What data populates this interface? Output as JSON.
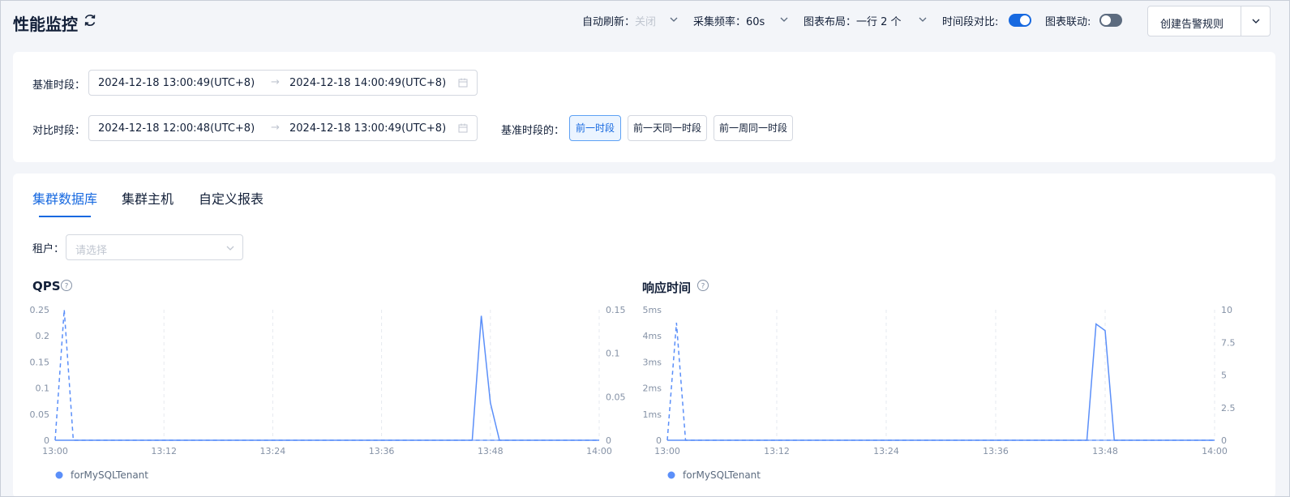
{
  "header": {
    "title": "性能监控",
    "auto_refresh_label": "自动刷新：",
    "auto_refresh_value": "关闭",
    "interval_label": "采集频率：",
    "interval_value": "60s",
    "layout_label": "图表布局：",
    "layout_value": "一行 2 个",
    "compare_label": "时间段对比:",
    "compare_on": true,
    "linkage_label": "图表联动:",
    "linkage_on": false,
    "create_alert_label": "创建告警规则"
  },
  "time_compare": {
    "base_label": "基准时段：",
    "base_start": "2024-12-18 13:00:49(UTC+8)",
    "base_end": "2024-12-18 14:00:49(UTC+8)",
    "compare_label": "对比时段：",
    "compare_start": "2024-12-18 12:00:48(UTC+8)",
    "compare_end": "2024-12-18 13:00:49(UTC+8)",
    "arrow": "→",
    "relative_label": "基准时段的：",
    "options": [
      "前一时段",
      "前一天同一时段",
      "前一周同一时段"
    ],
    "active_option": "前一时段"
  },
  "tabs": [
    {
      "label": "集群数据库",
      "active": true
    },
    {
      "label": "集群主机",
      "active": false
    },
    {
      "label": "自定义报表",
      "active": false
    }
  ],
  "tenant": {
    "label": "租户：",
    "placeholder": "请选择"
  },
  "colors": {
    "accent": "#1769e0",
    "series": "#5b8ff9",
    "toggle_on": "#1769e0",
    "toggle_off": "#5c6b7f"
  },
  "chart_data": [
    {
      "type": "line",
      "title": "QPS",
      "x": [
        "13:00",
        "13:01",
        "13:02",
        "13:03",
        "13:46",
        "13:47",
        "13:48",
        "13:49",
        "13:50",
        "14:00"
      ],
      "x_ticks": [
        "13:00",
        "13:12",
        "13:24",
        "13:36",
        "13:48",
        "14:00"
      ],
      "y_left_ticks": [
        "0",
        "0.05",
        "0.1",
        "0.15",
        "0.2",
        "0.25"
      ],
      "y_left_range": [
        0,
        0.25
      ],
      "y_right_ticks": [
        "0",
        "0.05",
        "0.1",
        "0.15"
      ],
      "y_right_range": [
        0,
        0.15
      ],
      "series": [
        {
          "name": "forMySQLTenant",
          "axis": "left",
          "style": "dashed",
          "points": [
            [
              "13:00",
              0
            ],
            [
              "13:01",
              0.25
            ],
            [
              "13:02",
              0
            ],
            [
              "14:00",
              0
            ]
          ]
        },
        {
          "name": "forMySQLTenant",
          "axis": "right",
          "style": "solid",
          "points": [
            [
              "13:00",
              0
            ],
            [
              "13:46",
              0
            ],
            [
              "13:47",
              0.143
            ],
            [
              "13:48",
              0.043
            ],
            [
              "13:49",
              0
            ],
            [
              "14:00",
              0
            ]
          ]
        }
      ],
      "legend": [
        "forMySQLTenant"
      ],
      "grid": true
    },
    {
      "type": "line",
      "title": "响应时间",
      "x": [
        "13:00",
        "13:01",
        "13:02",
        "13:46",
        "13:47",
        "13:48",
        "13:49",
        "14:00"
      ],
      "x_ticks": [
        "13:00",
        "13:12",
        "13:24",
        "13:36",
        "13:48",
        "14:00"
      ],
      "y_left_ticks": [
        "0",
        "1ms",
        "2ms",
        "3ms",
        "4ms",
        "5ms"
      ],
      "y_left_range": [
        0,
        5
      ],
      "y_right_ticks": [
        "0",
        "2.5",
        "5",
        "7.5",
        "10"
      ],
      "y_right_range": [
        0,
        10
      ],
      "series": [
        {
          "name": "forMySQLTenant",
          "axis": "left",
          "style": "dashed",
          "points": [
            [
              "13:00",
              0
            ],
            [
              "13:01",
              4.5
            ],
            [
              "13:02",
              0
            ],
            [
              "14:00",
              0
            ]
          ]
        },
        {
          "name": "forMySQLTenant",
          "axis": "right",
          "style": "solid",
          "points": [
            [
              "13:00",
              0
            ],
            [
              "13:46",
              0
            ],
            [
              "13:47",
              8.9
            ],
            [
              "13:48",
              8.4
            ],
            [
              "13:49",
              0
            ],
            [
              "14:00",
              0
            ]
          ]
        }
      ],
      "legend": [
        "forMySQLTenant"
      ],
      "grid": true
    }
  ]
}
